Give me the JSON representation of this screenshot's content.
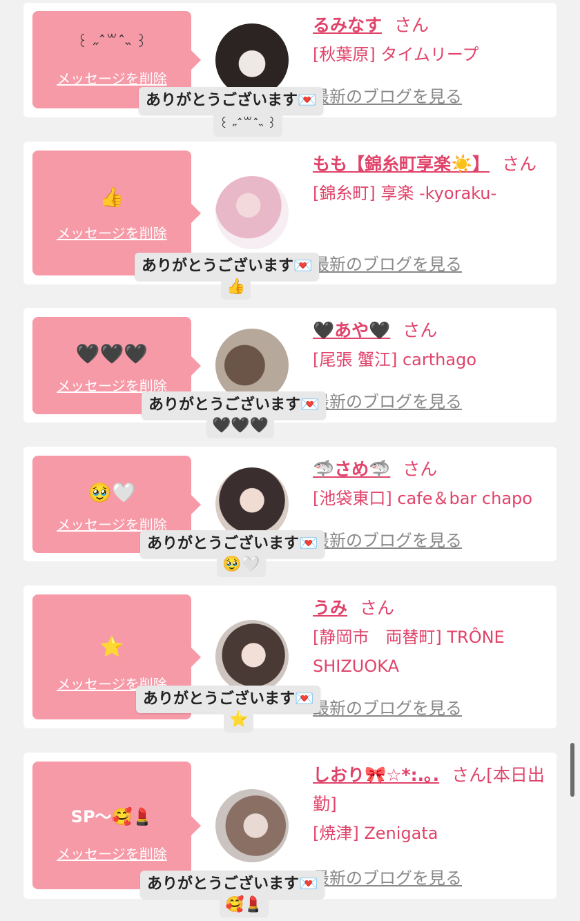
{
  "common": {
    "delete_label": "メッセージを削除",
    "thanks_label": "ありがとうございます💌",
    "blog_label": "最新のブログを見る",
    "honorific": "さん"
  },
  "cards": [
    {
      "stamp": "꒰ ˶ˆ꒳ˆ˵ ꒱",
      "name": "るみなす",
      "name_suffix": "",
      "shop": "[秋葉原] タイムリープ",
      "reply": "꒰ ˶ˆ꒳ˆ˵ ꒱"
    },
    {
      "stamp": "👍",
      "name": "もも【錦糸町享楽☀️】",
      "name_suffix": "",
      "shop": "[錦糸町] 享楽 -kyoraku-",
      "reply": "👍"
    },
    {
      "stamp": "🖤🖤🖤",
      "name": "🖤あや🖤",
      "name_suffix": "",
      "shop": "[尾張 蟹江] carthago",
      "reply": "🖤🖤🖤"
    },
    {
      "stamp": "🥹🤍",
      "name": "🦈さめ🦈",
      "name_suffix": "",
      "shop": "[池袋東口] cafe＆bar chapo",
      "reply": "🥹🤍"
    },
    {
      "stamp": "⭐️",
      "name": "うみ",
      "name_suffix": "",
      "shop": "[静岡市　両替町] TRÔNE SHIZUOKA",
      "reply": "⭐️"
    },
    {
      "stamp": "SP〜🥰💄",
      "name": "しおり🎀☆*:.｡.",
      "name_suffix": "[本日出勤]",
      "shop": "[焼津] Zenigata",
      "reply": "🥰💄"
    }
  ],
  "colors": {
    "bubble": "#f79aa8",
    "name": "#e0436a",
    "page_bg": "#f1f1f1",
    "card_bg": "#ffffff"
  }
}
